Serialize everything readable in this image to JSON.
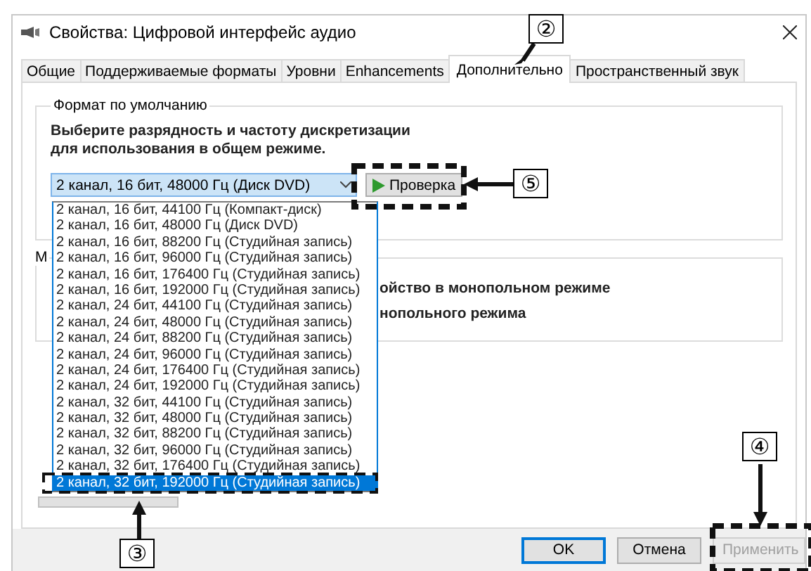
{
  "window": {
    "title": "Свойства: Цифровой интерфейс аудио"
  },
  "tabs": [
    {
      "label": "Общие",
      "selected": false
    },
    {
      "label": "Поддерживаемые форматы",
      "selected": false
    },
    {
      "label": "Уровни",
      "selected": false
    },
    {
      "label": "Enhancements",
      "selected": false
    },
    {
      "label": "Дополнительно",
      "selected": true
    },
    {
      "label": "Пространственный звук",
      "selected": false
    }
  ],
  "default_format": {
    "title": "Формат по умолчанию",
    "description": "Выберите разрядность и частоту дискретизации для использования в общем режиме.",
    "combo_value": "2 канал, 16 бит, 48000 Гц (Диск DVD)",
    "test_button": "Проверка",
    "options": [
      {
        "label": "2 канал, 16 бит, 44100 Гц (Компакт-диск)",
        "selected": false
      },
      {
        "label": "2 канал, 16 бит, 48000 Гц (Диск DVD)",
        "selected": false
      },
      {
        "label": "2 канал, 16 бит, 88200 Гц (Студийная запись)",
        "selected": false
      },
      {
        "label": "2 канал, 16 бит, 96000 Гц (Студийная запись)",
        "selected": false
      },
      {
        "label": "2 канал, 16 бит, 176400 Гц (Студийная запись)",
        "selected": false
      },
      {
        "label": "2 канал, 16 бит, 192000 Гц (Студийная запись)",
        "selected": false
      },
      {
        "label": "2 канал, 24 бит, 44100 Гц (Студийная запись)",
        "selected": false
      },
      {
        "label": "2 канал, 24 бит, 48000 Гц (Студийная запись)",
        "selected": false
      },
      {
        "label": "2 канал, 24 бит, 88200 Гц (Студийная запись)",
        "selected": false
      },
      {
        "label": "2 канал, 24 бит, 96000 Гц (Студийная запись)",
        "selected": false
      },
      {
        "label": "2 канал, 24 бит, 176400 Гц (Студийная запись)",
        "selected": false
      },
      {
        "label": "2 канал, 24 бит, 192000 Гц (Студийная запись)",
        "selected": false
      },
      {
        "label": "2 канал, 32 бит, 44100 Гц (Студийная запись)",
        "selected": false
      },
      {
        "label": "2 канал, 32 бит, 48000 Гц (Студийная запись)",
        "selected": false
      },
      {
        "label": "2 канал, 32 бит, 88200 Гц (Студийная запись)",
        "selected": false
      },
      {
        "label": "2 канал, 32 бит, 96000 Гц (Студийная запись)",
        "selected": false
      },
      {
        "label": "2 канал, 32 бит, 176400 Гц (Студийная запись)",
        "selected": false
      },
      {
        "label": "2 канал, 32 бит, 192000 Гц (Студийная запись)",
        "selected": true
      }
    ]
  },
  "exclusive_mode": {
    "title": "М",
    "lines": [
      "ойство в монопольном режиме",
      "нопольного режима"
    ]
  },
  "buttons": [
    {
      "label": "OK",
      "disabled": false,
      "focused": true
    },
    {
      "label": "Отмена",
      "disabled": false,
      "focused": false
    },
    {
      "label": "Применить",
      "disabled": true,
      "focused": false
    }
  ],
  "callouts": [
    {
      "label": "②"
    },
    {
      "label": "⑤"
    },
    {
      "label": "③"
    },
    {
      "label": "④"
    }
  ]
}
